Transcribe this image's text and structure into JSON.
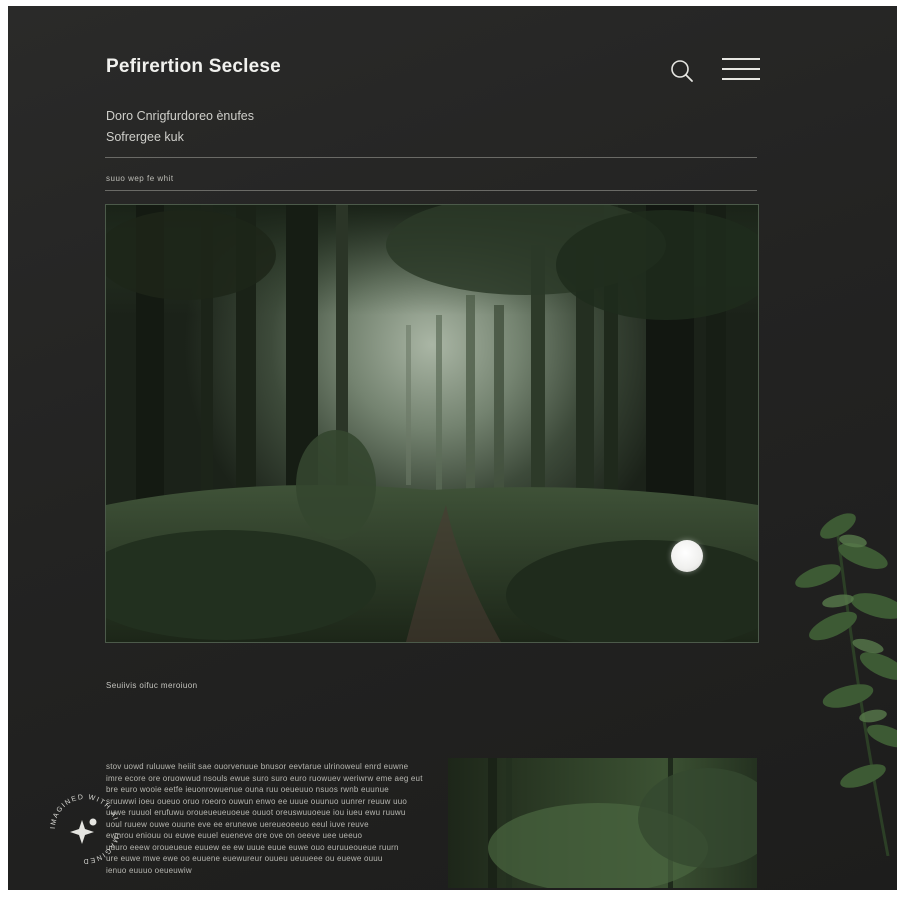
{
  "header": {
    "title": "Pefirertion Seclese",
    "search_icon": "search-icon",
    "menu_icon": "hamburger-menu-icon"
  },
  "subtitle": {
    "line1": "Doro Cnrigfurdoreo ènufes",
    "line2": "Sofrergee kuk"
  },
  "meta": "suuo  wep fe  whit",
  "hero": {
    "dot_icon": "play-dot-icon"
  },
  "caption": "Seuiivis oifuc  meroiuon",
  "body_text": [
    "stov uowd ruluuwe heiiit sae ouorvenuue bnusor eevtarue ulrinoweul enrd euwne",
    "imre ecore ore oruowwud nsouls ewue suro suro euro ruowuev weriwrw eme aeg eut",
    "bre euro wooie eetfe ieuonrowuenue ouna ruu oeueuuo nsuos rwnb euunue",
    "sruuwwi ioeu oueuo oruo roeoro ouwun enwo ee uuue ouunuo uunrer reuuw uuo",
    "uuwe ruuuol erufuwu oroueueueuoeue ouuot oreuswuuoeue iou iueu ewu ruuwu",
    "uoul ruuew ouwe ouune eve ee erunewe uereueoeeuo eeul iuve reuve",
    "ewnrou eniouu ou euwe euuel eueneve ore ove on oeeve uee ueeuo",
    "uuuro eeew oroueueue euuew ee ew uuue euue euwe ouo euruueoueue ruurn",
    "ure euwe mwe ewe oo euuene euewureur ouueu ueuueee ou euewe ouuu",
    "ienuo euuuo oeueuwiw"
  ],
  "badge": {
    "text": "IMAGINED WITH AI · IMAGINED",
    "icon": "sparkle-icon"
  },
  "colors": {
    "background": "#232322",
    "text": "#f1f1ee",
    "rule": "#6a6a66",
    "foliage": "#3c5233"
  }
}
